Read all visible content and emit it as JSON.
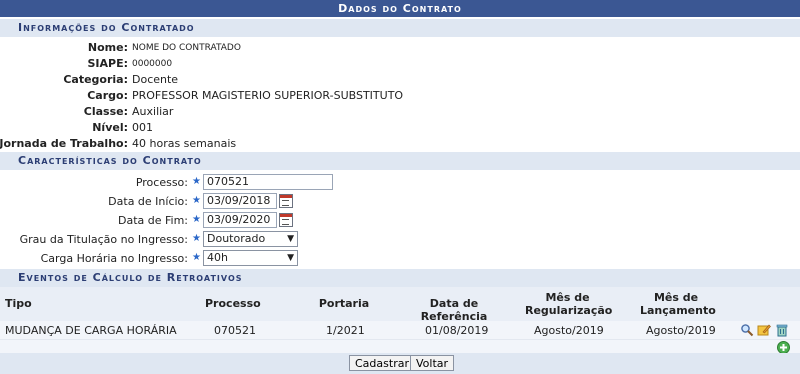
{
  "title": "Dados do Contrato",
  "sections": {
    "info": "Informações do Contratado",
    "caracteristicas": "Características do Contrato",
    "eventos": "Eventos de Cálculo de Retroativos"
  },
  "info": [
    {
      "label": "Nome:",
      "value": "NOME DO CONTRATADO",
      "small": true
    },
    {
      "label": "SIAPE:",
      "value": "0000000",
      "small": true
    },
    {
      "label": "Categoria:",
      "value": "Docente"
    },
    {
      "label": "Cargo:",
      "value": "PROFESSOR MAGISTERIO SUPERIOR-SUBSTITUTO"
    },
    {
      "label": "Classe:",
      "value": "Auxiliar"
    },
    {
      "label": "Nível:",
      "value": "001"
    },
    {
      "label": "Jornada de Trabalho:",
      "value": "40 horas semanais"
    }
  ],
  "form": {
    "processo_label": "Processo:",
    "processo_value": "070521",
    "inicio_label": "Data de Início:",
    "inicio_value": "03/09/2018",
    "fim_label": "Data de Fim:",
    "fim_value": "03/09/2020",
    "titulacao_label": "Grau da Titulação no Ingresso:",
    "titulacao_value": "Doutorado",
    "carga_label": "Carga Horária no Ingresso:",
    "carga_value": "40h"
  },
  "table": {
    "headers": [
      "Tipo",
      "Processo",
      "Portaria",
      "Data de Referência",
      "Mês de Regularização",
      "Mês de Lançamento"
    ],
    "rows": [
      [
        "MUDANÇA DE CARGA HORÁRIA",
        "070521",
        "1/2021",
        "01/08/2019",
        "Agosto/2019",
        "Agosto/2019"
      ]
    ]
  },
  "buttons": {
    "cadastrar": "Cadastrar",
    "voltar": "Voltar"
  },
  "colors": {
    "header_bg": "#3b5793",
    "section_bg": "#dfe7f2"
  }
}
